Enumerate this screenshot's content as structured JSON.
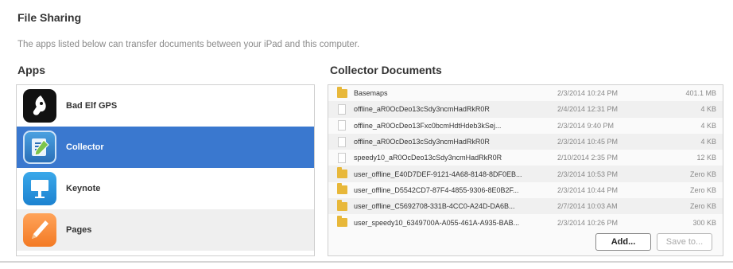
{
  "page": {
    "title": "File Sharing",
    "subtitle": "The apps listed below can transfer documents between your iPad and this computer."
  },
  "apps": {
    "header": "Apps",
    "items": [
      {
        "name": "Bad Elf GPS",
        "icon": "bad-elf-gps-icon",
        "selected": false
      },
      {
        "name": "Collector",
        "icon": "collector-icon",
        "selected": true
      },
      {
        "name": "Keynote",
        "icon": "keynote-icon",
        "selected": false
      },
      {
        "name": "Pages",
        "icon": "pages-icon",
        "selected": false
      }
    ]
  },
  "documents": {
    "header": "Collector Documents",
    "rows": [
      {
        "name": "Basemaps",
        "date": "2/3/2014 10:24 PM",
        "size": "401.1 MB",
        "type": "folder"
      },
      {
        "name": "offline_aR0OcDeo13cSdy3ncmHadRkR0R",
        "date": "2/4/2014 12:31 PM",
        "size": "4 KB",
        "type": "file"
      },
      {
        "name": "offline_aR0OcDeo13Fxc0bcmHdtHdeb3kSej...",
        "date": "2/3/2014 9:40 PM",
        "size": "4 KB",
        "type": "file"
      },
      {
        "name": "offline_aR0OcDeo13cSdy3ncmHadRkR0R",
        "date": "2/3/2014 10:45 PM",
        "size": "4 KB",
        "type": "file"
      },
      {
        "name": "speedy10_aR0OcDeo13cSdy3ncmHadRkR0R",
        "date": "2/10/2014 2:35 PM",
        "size": "12 KB",
        "type": "file"
      },
      {
        "name": "user_offline_E40D7DEF-9121-4A68-8148-8DF0EB...",
        "date": "2/3/2014 10:53 PM",
        "size": "Zero KB",
        "type": "folder"
      },
      {
        "name": "user_offline_D5542CD7-87F4-4855-9306-8E0B2F...",
        "date": "2/3/2014 10:44 PM",
        "size": "Zero KB",
        "type": "folder"
      },
      {
        "name": "user_offline_C5692708-331B-4CC0-A24D-DA6B...",
        "date": "2/7/2014 10:03 AM",
        "size": "Zero KB",
        "type": "folder"
      },
      {
        "name": "user_speedy10_6349700A-A055-461A-A935-BAB...",
        "date": "2/3/2014 10:26 PM",
        "size": "300 KB",
        "type": "folder"
      }
    ]
  },
  "buttons": {
    "add": "Add...",
    "save": "Save to..."
  },
  "colors": {
    "selection": "#3a78cf",
    "folder": "#e8b83a"
  }
}
